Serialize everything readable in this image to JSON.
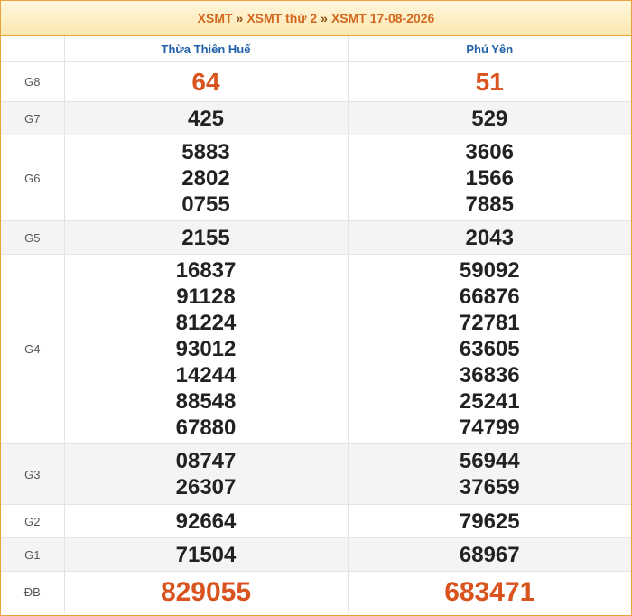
{
  "breadcrumb": {
    "items": [
      "XSMT",
      "XSMT thứ 2",
      "XSMT 17-08-2026"
    ],
    "separator": "»"
  },
  "provinces": [
    "Thừa Thiên Huế",
    "Phú Yên"
  ],
  "prizes": [
    {
      "label": "G8",
      "results": [
        [
          "64"
        ],
        [
          "51"
        ]
      ]
    },
    {
      "label": "G7",
      "results": [
        [
          "425"
        ],
        [
          "529"
        ]
      ]
    },
    {
      "label": "G6",
      "results": [
        [
          "5883",
          "2802",
          "0755"
        ],
        [
          "3606",
          "1566",
          "7885"
        ]
      ]
    },
    {
      "label": "G5",
      "results": [
        [
          "2155"
        ],
        [
          "2043"
        ]
      ]
    },
    {
      "label": "G4",
      "results": [
        [
          "16837",
          "91128",
          "81224",
          "93012",
          "14244",
          "88548",
          "67880"
        ],
        [
          "59092",
          "66876",
          "72781",
          "63605",
          "36836",
          "25241",
          "74799"
        ]
      ]
    },
    {
      "label": "G3",
      "results": [
        [
          "08747",
          "26307"
        ],
        [
          "56944",
          "37659"
        ]
      ]
    },
    {
      "label": "G2",
      "results": [
        [
          "92664"
        ],
        [
          "79625"
        ]
      ]
    },
    {
      "label": "G1",
      "results": [
        [
          "71504"
        ],
        [
          "68967"
        ]
      ]
    },
    {
      "label": "ĐB",
      "results": [
        [
          "829055"
        ],
        [
          "683471"
        ]
      ]
    }
  ],
  "colors": {
    "accent_border": "#e8a33d",
    "title_text": "#d2691e",
    "province_text": "#1f5fa8",
    "highlight_number": "#d9531e"
  }
}
